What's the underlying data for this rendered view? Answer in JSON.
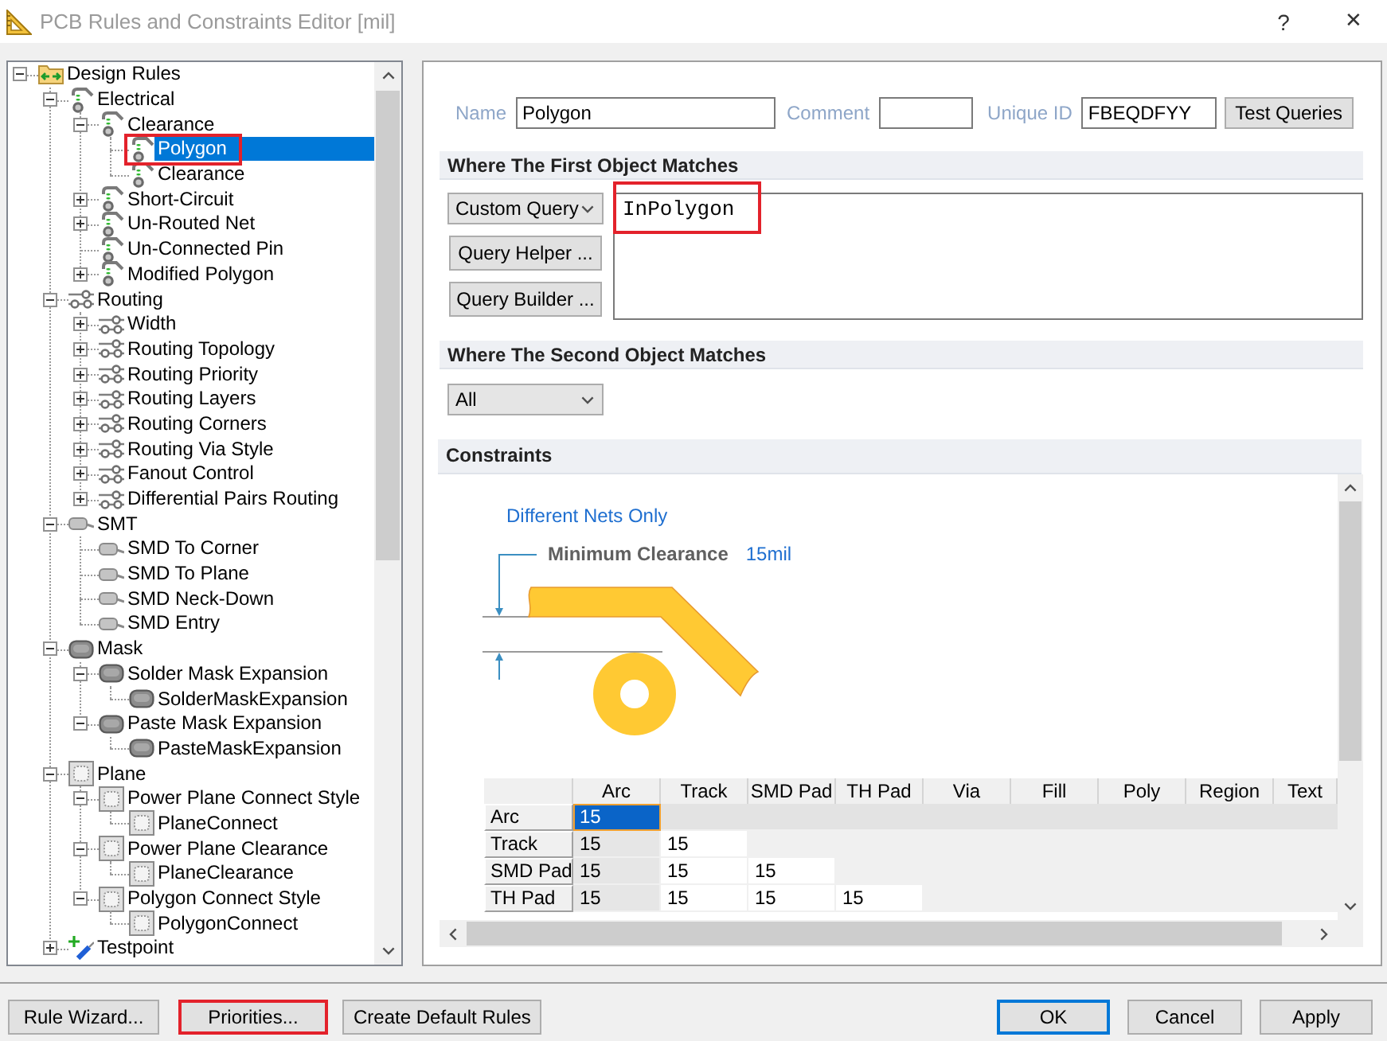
{
  "window": {
    "title": "PCB Rules and Constraints Editor [mil]",
    "help": "?",
    "close": "✕"
  },
  "rule_tree": {
    "items": [
      {
        "label": "Design Rules",
        "kind": "rule_set",
        "expanded": true,
        "selected": false,
        "children": [
          {
            "label": "Electrical",
            "kind": "electrical",
            "expanded": true,
            "selected": false,
            "children": [
              {
                "label": "Clearance",
                "kind": "electrical",
                "expanded": true,
                "selected": false,
                "children": [
                  {
                    "label": "Polygon",
                    "kind": "electrical",
                    "selected": true,
                    "annotated": true
                  },
                  {
                    "label": "Clearance",
                    "kind": "electrical",
                    "selected": false
                  }
                ]
              },
              {
                "label": "Short-Circuit",
                "kind": "electrical",
                "expanded": false,
                "selected": false
              },
              {
                "label": "Un-Routed Net",
                "kind": "electrical",
                "expanded": false,
                "selected": false
              },
              {
                "label": "Un-Connected Pin",
                "kind": "electrical",
                "selected": false
              },
              {
                "label": "Modified Polygon",
                "kind": "electrical",
                "expanded": false,
                "selected": false
              }
            ]
          },
          {
            "label": "Routing",
            "kind": "routing",
            "expanded": true,
            "selected": false,
            "children": [
              {
                "label": "Width",
                "kind": "routing",
                "expanded": false,
                "selected": false
              },
              {
                "label": "Routing Topology",
                "kind": "routing",
                "expanded": false,
                "selected": false
              },
              {
                "label": "Routing Priority",
                "kind": "routing",
                "expanded": false,
                "selected": false
              },
              {
                "label": "Routing Layers",
                "kind": "routing",
                "expanded": false,
                "selected": false
              },
              {
                "label": "Routing Corners",
                "kind": "routing",
                "expanded": false,
                "selected": false
              },
              {
                "label": "Routing Via Style",
                "kind": "routing",
                "expanded": false,
                "selected": false
              },
              {
                "label": "Fanout Control",
                "kind": "routing",
                "expanded": false,
                "selected": false
              },
              {
                "label": "Differential Pairs Routing",
                "kind": "routing",
                "expanded": false,
                "selected": false
              }
            ]
          },
          {
            "label": "SMT",
            "kind": "smt",
            "expanded": true,
            "selected": false,
            "children": [
              {
                "label": "SMD To Corner",
                "kind": "smt",
                "selected": false
              },
              {
                "label": "SMD To Plane",
                "kind": "smt",
                "selected": false
              },
              {
                "label": "SMD Neck-Down",
                "kind": "smt",
                "selected": false
              },
              {
                "label": "SMD Entry",
                "kind": "smt",
                "selected": false
              }
            ]
          },
          {
            "label": "Mask",
            "kind": "mask",
            "expanded": true,
            "selected": false,
            "children": [
              {
                "label": "Solder Mask Expansion",
                "kind": "mask",
                "expanded": true,
                "selected": false,
                "children": [
                  {
                    "label": "SolderMaskExpansion",
                    "kind": "mask",
                    "selected": false
                  }
                ]
              },
              {
                "label": "Paste Mask Expansion",
                "kind": "mask",
                "expanded": true,
                "selected": false,
                "children": [
                  {
                    "label": "PasteMaskExpansion",
                    "kind": "mask",
                    "selected": false
                  }
                ]
              }
            ]
          },
          {
            "label": "Plane",
            "kind": "plane",
            "expanded": true,
            "selected": false,
            "children": [
              {
                "label": "Power Plane Connect Style",
                "kind": "plane",
                "expanded": true,
                "selected": false,
                "children": [
                  {
                    "label": "PlaneConnect",
                    "kind": "plane",
                    "selected": false
                  }
                ]
              },
              {
                "label": "Power Plane Clearance",
                "kind": "plane",
                "expanded": true,
                "selected": false,
                "children": [
                  {
                    "label": "PlaneClearance",
                    "kind": "plane",
                    "selected": false
                  }
                ]
              },
              {
                "label": "Polygon Connect Style",
                "kind": "plane",
                "expanded": true,
                "selected": false,
                "children": [
                  {
                    "label": "PolygonConnect",
                    "kind": "plane",
                    "selected": false
                  }
                ]
              }
            ]
          },
          {
            "label": "Testpoint",
            "kind": "testpoint",
            "expanded": false,
            "selected": false
          }
        ]
      }
    ]
  },
  "rule": {
    "name_label": "Name",
    "name": "Polygon",
    "comment_label": "Comment",
    "unique_id_label": "Unique ID",
    "unique_id": "FBEQDFYY",
    "test_button": "Test Queries"
  },
  "first_object": {
    "title": "Where The First Object Matches",
    "query_type": "Custom Query",
    "helper_button": "Query Helper ...",
    "builder_button": "Query Builder ...",
    "query": "InPolygon",
    "query_annotated": true
  },
  "second_object": {
    "title": "Where The Second Object Matches",
    "query_type": "All"
  },
  "constraints": {
    "title": "Constraints",
    "net_scope": "Different Nets Only",
    "clearance_label": "Minimum Clearance",
    "clearance_value": "15mil",
    "matrix": {
      "columns": [
        "Arc",
        "Track",
        "SMD Pad",
        "TH Pad",
        "Via",
        "Fill",
        "Poly",
        "Region",
        "Text"
      ],
      "rows": [
        {
          "label": "Arc",
          "cells": [
            {
              "value": "15",
              "selected": true
            }
          ]
        },
        {
          "label": "Track",
          "cells": [
            {
              "value": "15",
              "selected": false
            },
            {
              "value": "15",
              "selected": false
            }
          ]
        },
        {
          "label": "SMD Pad",
          "cells": [
            {
              "value": "15",
              "selected": false
            },
            {
              "value": "15",
              "selected": false
            },
            {
              "value": "15",
              "selected": false
            }
          ]
        },
        {
          "label": "TH Pad",
          "cells": [
            {
              "value": "15",
              "selected": false
            },
            {
              "value": "15",
              "selected": false
            },
            {
              "value": "15",
              "selected": false
            },
            {
              "value": "15",
              "selected": false
            }
          ]
        }
      ]
    }
  },
  "dialog_buttons": {
    "left": [
      {
        "label": "Rule Wizard...",
        "default": false
      },
      {
        "label": "Priorities...",
        "default": false,
        "annotated": true
      },
      {
        "label": "Create Default Rules",
        "default": false
      }
    ],
    "right": [
      {
        "label": "OK",
        "default": true
      },
      {
        "label": "Cancel",
        "default": false
      },
      {
        "label": "Apply",
        "default": false
      }
    ]
  }
}
